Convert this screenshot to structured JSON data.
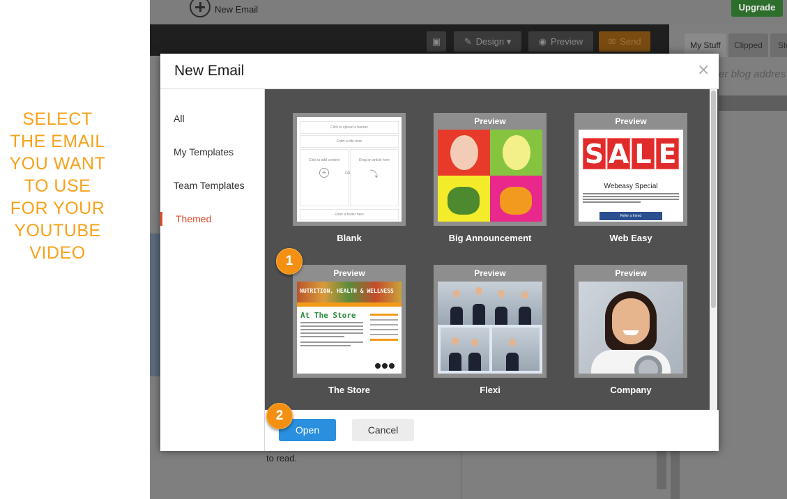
{
  "instruction": {
    "lines": [
      "SELECT",
      "THE EMAIL",
      "YOU WANT",
      "TO USE",
      "FOR YOUR",
      "YOUTUBE",
      "VIDEO"
    ],
    "color": "#f7a21b"
  },
  "background_app": {
    "new_email_label": "New Email",
    "upgrade_label": "Upgrade",
    "toolbar": {
      "design_label": "Design ▾",
      "preview_label": "Preview",
      "send_label": "Send"
    },
    "side_tabs": [
      "My Stuff",
      "Clipped",
      "Sto"
    ],
    "side_search_placeholder": "ter blog addres",
    "body_text": "to read."
  },
  "modal": {
    "title": "New Email",
    "close_symbol": "×",
    "categories": [
      "All",
      "My Templates",
      "Team Templates",
      "Themed"
    ],
    "active_category": "Themed",
    "accent_color": "#e04a2b",
    "templates": [
      {
        "name": "Blank",
        "header": ""
      },
      {
        "name": "Big Announcement",
        "header": "Preview"
      },
      {
        "name": "Web Easy",
        "header": "Preview"
      },
      {
        "name": "The Store",
        "header": "Preview"
      },
      {
        "name": "Flexi",
        "header": "Preview"
      },
      {
        "name": "Company",
        "header": "Preview"
      }
    ],
    "blank_thumb": {
      "banner": "Click to upload a banner",
      "title": "Enter a title here",
      "content": "Click to add content",
      "or": "OR",
      "article": "Drag an article here",
      "footer": "Enter a footer here"
    },
    "web_easy_thumb": {
      "sale_letters": [
        "S",
        "A",
        "L",
        "E"
      ],
      "subtitle": "Webeasy Special",
      "button": "Refer a friend"
    },
    "store_thumb": {
      "banner": "NUTRITION, HEALTH & WELLNESS",
      "heading": "At The Store"
    },
    "buttons": {
      "open": "Open",
      "cancel": "Cancel",
      "open_color": "#2a8fde"
    }
  },
  "badges": [
    "1",
    "2"
  ]
}
